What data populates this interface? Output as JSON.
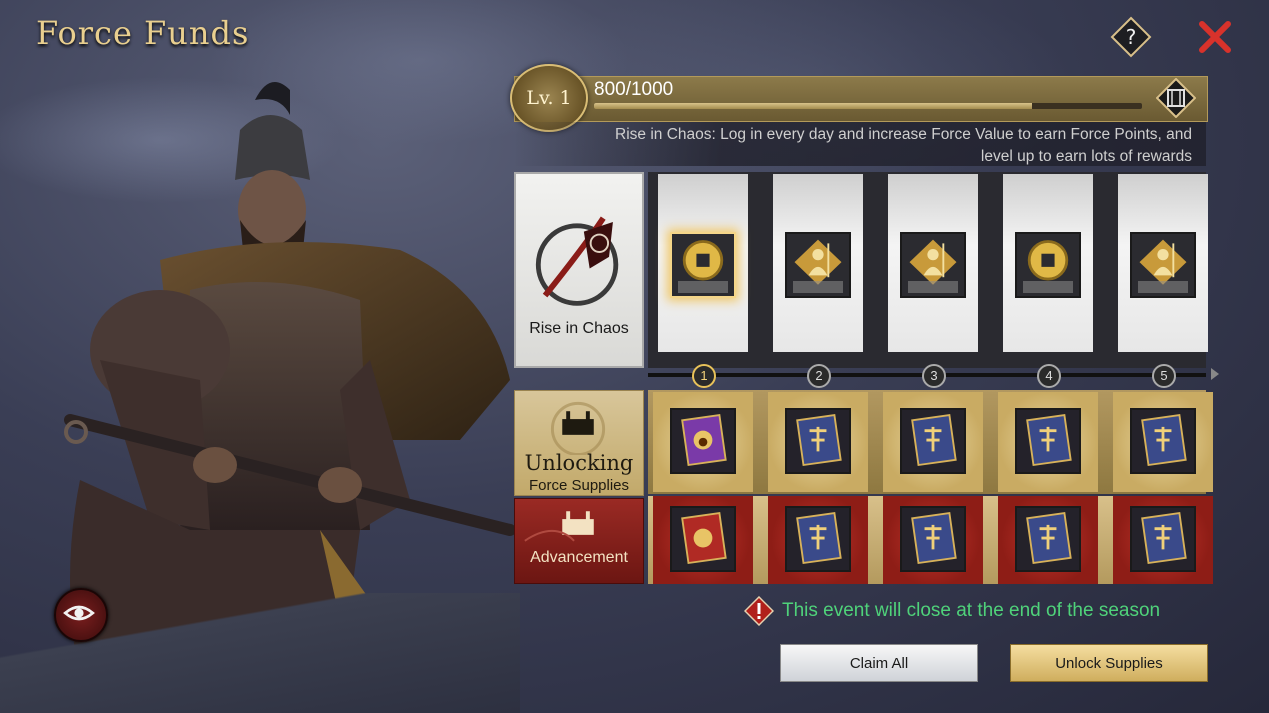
{
  "window": {
    "title": "Force Funds"
  },
  "level": {
    "label": "Lv. 1",
    "progress_text": "800/1000",
    "progress_fraction": 0.8
  },
  "description": {
    "line1": "Rise in Chaos: Log in every day and increase Force Value to earn Force Points, and",
    "line2": "level up to earn lots of rewards"
  },
  "categories": {
    "free": {
      "label": "Rise in Chaos"
    },
    "unlock": {
      "title": "Unlocking",
      "subtitle": "Force Supplies"
    },
    "advancement": {
      "label": "Advancement"
    }
  },
  "tiers": [
    {
      "number": "1",
      "active": true,
      "free_reward": "coin-icon",
      "unlock_reward": "purple-scroll-icon",
      "adv_reward": "red-scroll-icon"
    },
    {
      "number": "2",
      "active": false,
      "free_reward": "soldier-icon",
      "unlock_reward": "blue-scroll-icon",
      "adv_reward": "blue-scroll-icon"
    },
    {
      "number": "3",
      "active": false,
      "free_reward": "soldier-icon",
      "unlock_reward": "blue-scroll-icon",
      "adv_reward": "blue-scroll-icon"
    },
    {
      "number": "4",
      "active": false,
      "free_reward": "coin-icon",
      "unlock_reward": "blue-scroll-icon",
      "adv_reward": "blue-scroll-icon"
    },
    {
      "number": "5",
      "active": false,
      "free_reward": "soldier-icon",
      "unlock_reward": "blue-scroll-icon",
      "adv_reward": "blue-scroll-icon"
    }
  ],
  "notice": {
    "text": "This event will close at the end of the season"
  },
  "buttons": {
    "claim_all": "Claim All",
    "unlock_supplies": "Unlock Supplies"
  },
  "colors": {
    "accent_gold": "#e9cf8f",
    "notice_green": "#4fd27a",
    "close_red": "#d8322b"
  }
}
